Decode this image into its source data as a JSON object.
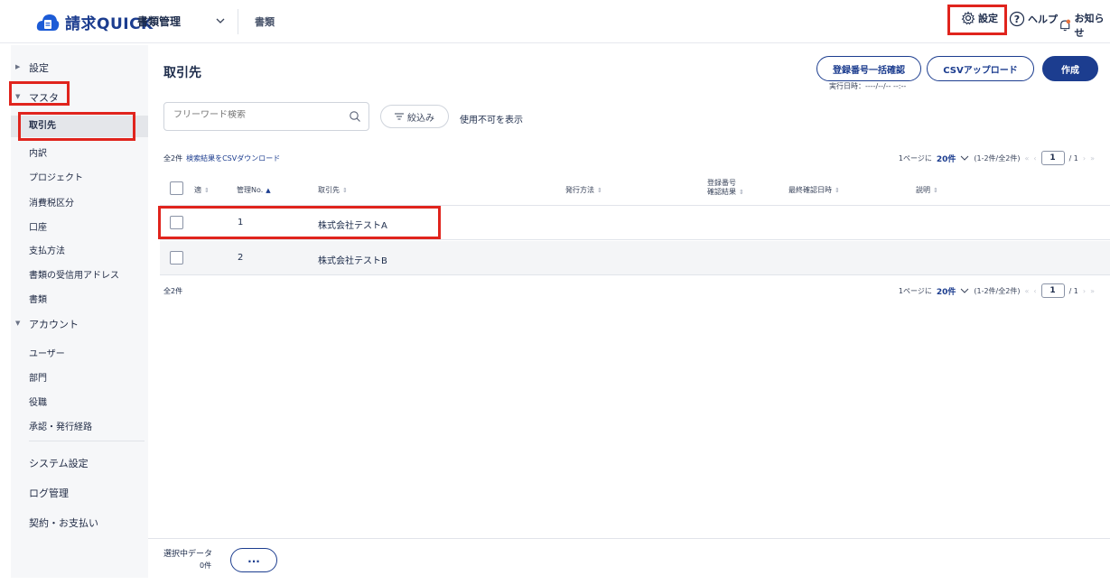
{
  "header": {
    "logo_text": "請求QUICK",
    "menu_label": "書類管理",
    "sub_link": "書類",
    "settings_label": "設定",
    "help_label": "ヘルプ",
    "notice_label": "お知らせ"
  },
  "sidebar": {
    "items": [
      {
        "label": "設定"
      },
      {
        "label": "マスタ"
      },
      {
        "label": "取引先"
      },
      {
        "label": "内訳"
      },
      {
        "label": "プロジェクト"
      },
      {
        "label": "消費税区分"
      },
      {
        "label": "口座"
      },
      {
        "label": "支払方法"
      },
      {
        "label": "書類の受信用アドレス"
      },
      {
        "label": "書類"
      },
      {
        "label": "アカウント"
      },
      {
        "label": "ユーザー"
      },
      {
        "label": "部門"
      },
      {
        "label": "役職"
      },
      {
        "label": "承認・発行経路"
      },
      {
        "label": "システム設定"
      },
      {
        "label": "ログ管理"
      },
      {
        "label": "契約・お支払い"
      }
    ]
  },
  "main": {
    "title": "取引先",
    "buttons": {
      "bulk_check": "登録番号一括確認",
      "csv_upload": "CSVアップロード",
      "create": "作成"
    },
    "exec_time": "実行日時：----/--/-- --:--",
    "search_placeholder": "フリーワード検索",
    "filter_label": "絞込み",
    "show_disabled": "使用不可を表示",
    "count_top": "全2件",
    "csv_download": "検索結果をCSVダウンロード",
    "count_bottom": "全2件",
    "pager": {
      "per_page_prefix": "1ページに",
      "per_page": "20件",
      "range": "(1-2件/全2件)",
      "page": "1",
      "total": "/ 1"
    },
    "table": {
      "columns": [
        "適",
        "管理No.",
        "取引先",
        "発行方法",
        "登録番号",
        "確認結果",
        "最終確認日時",
        "説明"
      ],
      "rows": [
        {
          "no": "1",
          "name": "株式会社テストA"
        },
        {
          "no": "2",
          "name": "株式会社テストB"
        }
      ]
    }
  },
  "footer": {
    "selected_label": "選択中データ",
    "selected_count": "0件",
    "more_label": "..."
  },
  "colors": {
    "brand": "#1c3d8f",
    "highlight": "#e0241d"
  }
}
